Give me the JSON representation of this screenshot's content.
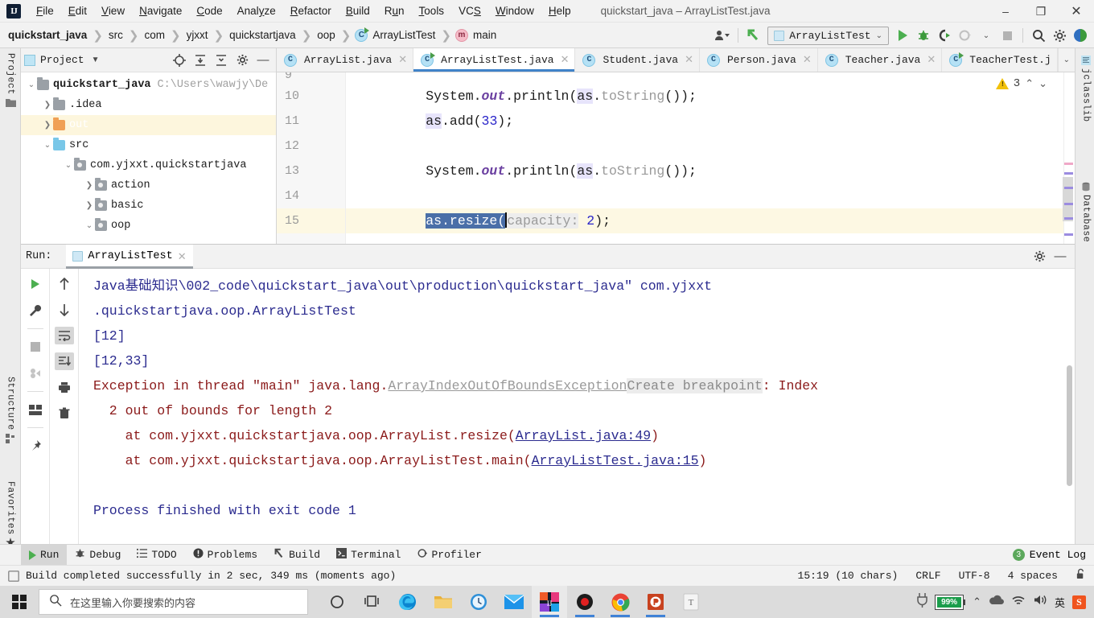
{
  "window": {
    "title": "quickstart_java – ArrayListTest.java",
    "logo": "intellij-idea-logo",
    "minimize": "–",
    "maximize": "❐",
    "close": "✕"
  },
  "menu": [
    {
      "label": "File"
    },
    {
      "label": "Edit"
    },
    {
      "label": "View"
    },
    {
      "label": "Navigate"
    },
    {
      "label": "Code"
    },
    {
      "label": "Analyze"
    },
    {
      "label": "Refactor"
    },
    {
      "label": "Build"
    },
    {
      "label": "Run"
    },
    {
      "label": "Tools"
    },
    {
      "label": "VCS"
    },
    {
      "label": "Window"
    },
    {
      "label": "Help"
    }
  ],
  "breadcrumbs": [
    {
      "label": "quickstart_java",
      "icon": "",
      "bold": true
    },
    {
      "label": "src",
      "icon": ""
    },
    {
      "label": "com",
      "icon": ""
    },
    {
      "label": "yjxxt",
      "icon": ""
    },
    {
      "label": "quickstartjava",
      "icon": ""
    },
    {
      "label": "oop",
      "icon": ""
    },
    {
      "label": "ArrayListTest",
      "icon": "class-icon"
    },
    {
      "label": "main",
      "icon": "method-icon"
    }
  ],
  "toolbar": {
    "user_icon": "user-settings-icon",
    "updates_icon": "vcs-update-icon",
    "run_config": "ArrayListTest",
    "run_icon": "run-icon",
    "debug_icon": "debug-icon",
    "coverage_icon": "run-with-coverage-icon",
    "profile_icon": "profile-icon",
    "stop_icon": "stop-icon",
    "search_icon": "search-everywhere-icon",
    "settings_icon": "settings-icon",
    "ide_icon": "ide-feature-icon"
  },
  "left_rail": [
    {
      "label": "Project",
      "icon": "project-icon"
    },
    {
      "label": "Structure",
      "icon": "structure-icon"
    },
    {
      "label": "Favorites",
      "icon": "favorites-star-icon"
    }
  ],
  "right_rail": [
    {
      "label": "jclasslib",
      "icon": "jclasslib-icon"
    },
    {
      "label": "Database",
      "icon": "database-icon"
    }
  ],
  "project_panel": {
    "title": "Project",
    "dropdown_icon": "chevron-down-icon",
    "buttons": [
      "locate-icon",
      "expand-all-icon",
      "collapse-all-icon",
      "settings-icon",
      "hide-icon"
    ],
    "tree": [
      {
        "label": "quickstart_java",
        "path": "C:\\Users\\wawjy\\De",
        "arrow": "v",
        "indent": 0,
        "folder": "module",
        "bold": true,
        "selected": false
      },
      {
        "label": ".idea",
        "path": "",
        "arrow": ">",
        "indent": 1,
        "folder": "gray",
        "bold": false,
        "selected": false
      },
      {
        "label": "out",
        "path": "",
        "arrow": ">",
        "indent": 1,
        "folder": "orange",
        "bold": false,
        "selected": true
      },
      {
        "label": "src",
        "path": "",
        "arrow": "v",
        "indent": 1,
        "folder": "blue",
        "bold": false,
        "selected": false
      },
      {
        "label": "com.yjxxt.quickstartjava",
        "path": "",
        "arrow": "v",
        "indent": 2,
        "folder": "pkg",
        "bold": false,
        "selected": false
      },
      {
        "label": "action",
        "path": "",
        "arrow": ">",
        "indent": 3,
        "folder": "pkg",
        "bold": false,
        "selected": false
      },
      {
        "label": "basic",
        "path": "",
        "arrow": ">",
        "indent": 3,
        "folder": "pkg",
        "bold": false,
        "selected": false
      },
      {
        "label": "oop",
        "path": "",
        "arrow": "v",
        "indent": 3,
        "folder": "pkg",
        "bold": false,
        "selected": false
      }
    ]
  },
  "editor": {
    "tabs": [
      {
        "label": "ArrayList.java",
        "icon": "class-icon",
        "active": false,
        "runnable": false
      },
      {
        "label": "ArrayListTest.java",
        "icon": "class-icon",
        "active": true,
        "runnable": true
      },
      {
        "label": "Student.java",
        "icon": "class-icon",
        "active": false,
        "runnable": false
      },
      {
        "label": "Person.java",
        "icon": "class-icon",
        "active": false,
        "runnable": false
      },
      {
        "label": "Teacher.java",
        "icon": "class-icon",
        "active": false,
        "runnable": false
      },
      {
        "label": "TeacherTest.j",
        "icon": "class-icon",
        "active": false,
        "runnable": true
      }
    ],
    "tabs_overflow_icon": "chevron-down-icon",
    "warning_count": "3",
    "warning_icon": "warning-triangle-icon",
    "prev_icon": "^",
    "next_icon": "v",
    "line_numbers": [
      "9",
      "10",
      "11",
      "12",
      "13",
      "14",
      "15"
    ],
    "current_line": "15",
    "lines": [
      {
        "n": "9",
        "text": ""
      },
      {
        "n": "10",
        "text": "        System.out.println(as.toString());"
      },
      {
        "n": "11",
        "text": "        as.add(33);"
      },
      {
        "n": "12",
        "text": ""
      },
      {
        "n": "13",
        "text": "        System.out.println(as.toString());"
      },
      {
        "n": "14",
        "text": ""
      },
      {
        "n": "15",
        "text": "        as.resize( capacity: 2);"
      }
    ],
    "hint_param": "capacity:",
    "selection_text": "as.resize("
  },
  "run_window": {
    "label": "Run:",
    "tab_name": "ArrayListTest",
    "tab_icon": "run-config-icon",
    "close_icon": "close-icon",
    "settings_icon": "settings-icon",
    "hide_icon": "hide-icon",
    "tools_left": [
      "rerun-icon",
      "wrench-icon",
      "stop-icon",
      "dump-threads-icon",
      "layout-icon",
      "pin-icon"
    ],
    "tools_right": [
      "up-arrow-icon",
      "down-arrow-icon",
      "soft-wrap-icon",
      "scroll-to-end-icon",
      "print-icon",
      "trash-icon"
    ],
    "console": [
      {
        "type": "cmd",
        "text": "Java基础知识\\002_code\\quickstart_java\\out\\production\\quickstart_java\" com.yjxxt"
      },
      {
        "type": "cmd",
        "text": ".quickstartjava.oop.ArrayListTest"
      },
      {
        "type": "out",
        "text": "[12]"
      },
      {
        "type": "out",
        "text": "[12,33]"
      },
      {
        "type": "exc_head",
        "prefix": "Exception in thread \"main\" java.lang.",
        "link": "ArrayIndexOutOfBoundsException",
        "breakpoint": "Create breakpoint",
        "suffix": ": Index"
      },
      {
        "type": "exc_cont",
        "text": "  2 out of bounds for length 2"
      },
      {
        "type": "stack",
        "prefix": "    at com.yjxxt.quickstartjava.oop.ArrayList.resize(",
        "link": "ArrayList.java:49",
        "suffix": ")"
      },
      {
        "type": "stack",
        "prefix": "    at com.yjxxt.quickstartjava.oop.ArrayListTest.main(",
        "link": "ArrayListTest.java:15",
        "suffix": ")"
      },
      {
        "type": "blank",
        "text": ""
      },
      {
        "type": "out",
        "text": "Process finished with exit code 1"
      }
    ]
  },
  "bottom_bar": {
    "items": [
      {
        "label": "Run",
        "icon": "run-icon",
        "active": true
      },
      {
        "label": "Debug",
        "icon": "debug-icon",
        "active": false
      },
      {
        "label": "TODO",
        "icon": "todo-icon",
        "active": false
      },
      {
        "label": "Problems",
        "icon": "problems-icon",
        "active": false
      },
      {
        "label": "Build",
        "icon": "build-hammer-icon",
        "active": false
      },
      {
        "label": "Terminal",
        "icon": "terminal-icon",
        "active": false
      },
      {
        "label": "Profiler",
        "icon": "profiler-icon",
        "active": false
      }
    ],
    "event_log": "Event Log",
    "event_count": "3"
  },
  "status_bar": {
    "build_icon": "build-status-icon",
    "message": "Build completed successfully in 2 sec, 349 ms (moments ago)",
    "position": "15:19 (10 chars)",
    "line_sep": "CRLF",
    "encoding": "UTF-8",
    "indent": "4 spaces",
    "lock_icon": "unlocked-icon"
  },
  "taskbar": {
    "start_icon": "windows-start-icon",
    "search_icon": "search-icon",
    "search_placeholder": "在这里输入你要搜索的内容",
    "icons": [
      {
        "name": "cortana-icon"
      },
      {
        "name": "task-view-icon"
      },
      {
        "name": "microsoft-edge-icon"
      },
      {
        "name": "file-explorer-icon"
      },
      {
        "name": "clock-app-icon"
      },
      {
        "name": "mail-icon"
      },
      {
        "name": "intellij-idea-icon"
      },
      {
        "name": "screen-recorder-icon"
      },
      {
        "name": "google-chrome-icon"
      },
      {
        "name": "powerpoint-icon"
      },
      {
        "name": "typora-icon"
      }
    ],
    "tray": {
      "battery": "99%",
      "chevron_icon": "show-hidden-icons-icon",
      "onedrive_icon": "onedrive-icon",
      "wifi_icon": "wifi-icon",
      "volume_icon": "volume-icon",
      "ime_icon": "ime-chinese-icon",
      "sogou_icon": "sogou-icon"
    }
  },
  "colors": {
    "accent": "#4083c9",
    "selection": "#4a6fa8",
    "current_line": "#fdf8e3",
    "error": "#8b1a1a",
    "console_blue": "#2b2b8f",
    "warning": "#f2c10a",
    "run_green": "#4caf50"
  }
}
